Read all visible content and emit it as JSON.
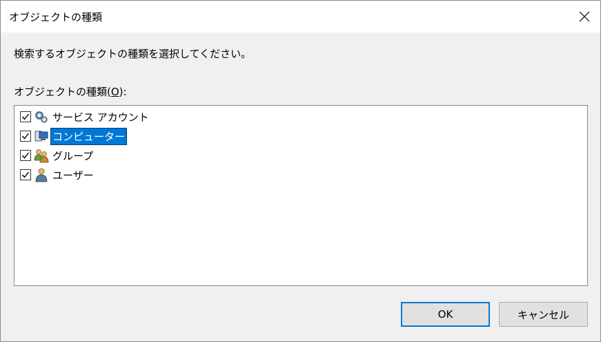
{
  "window": {
    "title": "オブジェクトの種類"
  },
  "dialog": {
    "instruction": "検索するオブジェクトの種類を選択してください。",
    "list_label_prefix": "オブジェクトの種類(",
    "list_label_mnemonic": "O",
    "list_label_suffix": "):",
    "items": [
      {
        "label": "サービス アカウント",
        "checked": true,
        "icon": "service-account-icon",
        "selected": false
      },
      {
        "label": "コンピューター",
        "checked": true,
        "icon": "computer-icon",
        "selected": true
      },
      {
        "label": "グループ",
        "checked": true,
        "icon": "group-icon",
        "selected": false
      },
      {
        "label": "ユーザー",
        "checked": true,
        "icon": "user-icon",
        "selected": false
      }
    ]
  },
  "buttons": {
    "ok": "OK",
    "cancel": "キャンセル"
  },
  "colors": {
    "selection": "#0078d7",
    "window_bg": "#f0f0f0",
    "default_border": "#0078d7"
  }
}
